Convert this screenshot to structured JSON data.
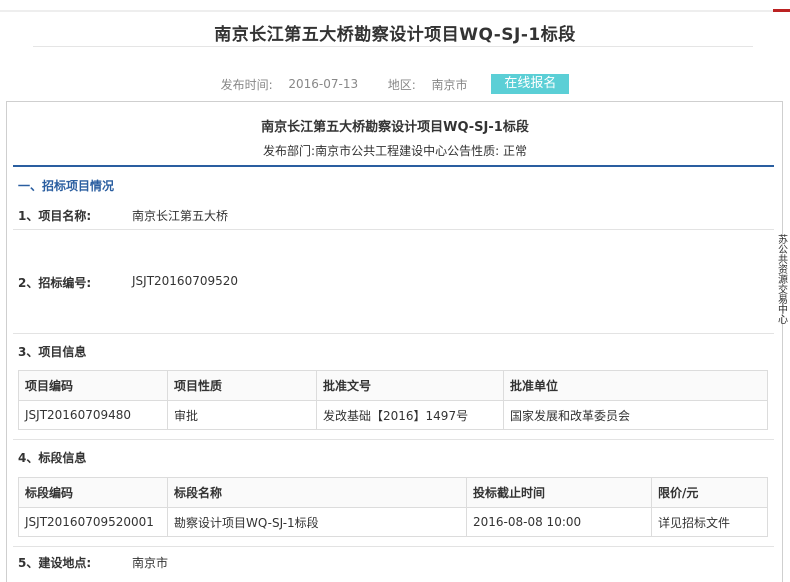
{
  "header": {
    "title": "南京长江第五大桥勘察设计项目WQ-SJ-1标段",
    "date_label": "发布时间:",
    "date_value": "2016-07-13",
    "region_label": "地区:",
    "region_value": "南京市",
    "apply_button": "在线报名"
  },
  "notice": {
    "title": "南京长江第五大桥勘察设计项目WQ-SJ-1标段",
    "subtitle": "发布部门:南京市公共工程建设中心公告性质: 正常"
  },
  "section1": {
    "heading": "一、招标项目情况",
    "item1_label": "1、项目名称:",
    "item1_value": "南京长江第五大桥",
    "item2_label": "2、招标编号:",
    "item2_value": "JSJT20160709520",
    "item3_label": "3、项目信息",
    "project_table": {
      "headers": [
        "项目编码",
        "项目性质",
        "批准文号",
        "批准单位"
      ],
      "row": [
        "JSJT20160709480",
        "审批",
        "发改基础【2016】1497号",
        "国家发展和改革委员会"
      ]
    },
    "item4_label": "4、标段信息",
    "section_table": {
      "headers": [
        "标段编码",
        "标段名称",
        "投标截止时间",
        "限价/元"
      ],
      "row": [
        "JSJT20160709520001",
        "勘察设计项目WQ-SJ-1标段",
        "2016-08-08 10:00",
        "详见招标文件"
      ]
    },
    "item5_label": "5、建设地点:",
    "item5_value": "南京市"
  },
  "side_text": "苏公共资源交易中心"
}
